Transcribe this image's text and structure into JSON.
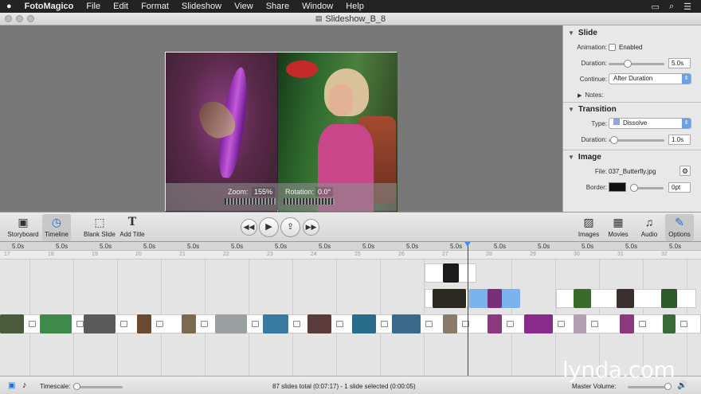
{
  "menubar": {
    "apple": "",
    "app": "FotoMagico",
    "items": [
      "File",
      "Edit",
      "Format",
      "Slideshow",
      "View",
      "Share",
      "Window",
      "Help"
    ],
    "right_icons": [
      "airplay-icon",
      "search-icon",
      "menu-icon"
    ]
  },
  "window": {
    "title": "Slideshow_B_8"
  },
  "stage": {
    "zoom_label": "Zoom:",
    "zoom_value": "155%",
    "rotation_label": "Rotation:",
    "rotation_value": "0.0°"
  },
  "inspector": {
    "slide": {
      "title": "Slide",
      "animation_label": "Animation:",
      "enabled_label": "Enabled",
      "enabled_checked": false,
      "duration_label": "Duration:",
      "duration_value": "5.0s",
      "continue_label": "Continue:",
      "continue_value": "After Duration",
      "notes_label": "Notes:"
    },
    "transition": {
      "title": "Transition",
      "type_label": "Type:",
      "type_value": "Dissolve",
      "duration_label": "Duration:",
      "duration_value": "1.0s"
    },
    "image": {
      "title": "Image",
      "file_label": "File:",
      "file_value": "037_Butterfly.jpg",
      "border_label": "Border:",
      "border_color": "#111111",
      "border_value": "0pt"
    }
  },
  "toolbar": {
    "storyboard": "Storyboard",
    "timeline": "Timeline",
    "blank_slide": "Blank Slide",
    "add_title": "Add Title",
    "images": "Images",
    "movies": "Movies",
    "audio": "Audio",
    "options": "Options"
  },
  "timeline": {
    "slide_duration": "5.0s",
    "slide_numbers": [
      "17",
      "18",
      "19",
      "20",
      "21",
      "22",
      "23",
      "24",
      "25",
      "26",
      "27",
      "28",
      "29",
      "30",
      "31",
      "32"
    ]
  },
  "statusbar": {
    "timescale_label": "Timescale:",
    "status": "87 slides total (0:07:17)  -  1 slide selected (0:00:05)",
    "master_volume_label": "Master Volume:"
  },
  "watermark": "lynda.com",
  "colors": {
    "accent": "#1f6fd1",
    "selection": "#7ab3ef"
  }
}
